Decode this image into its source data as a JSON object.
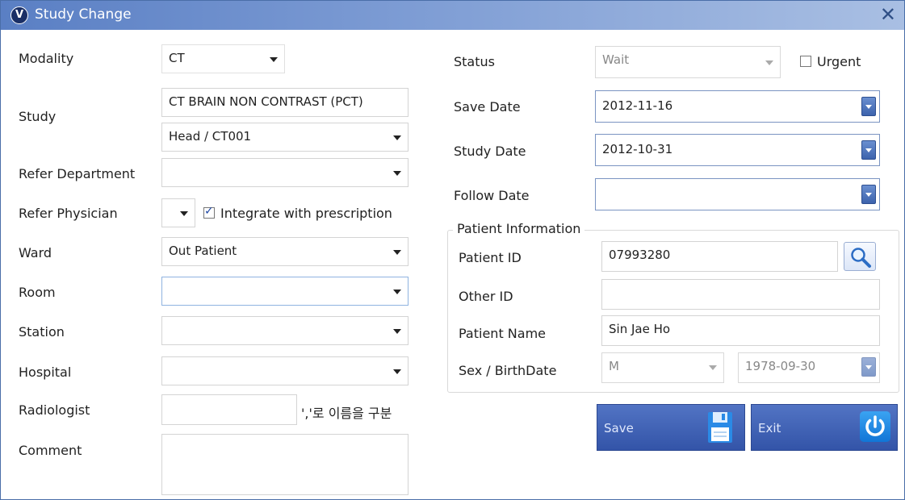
{
  "window": {
    "title": "Study Change",
    "app_icon_letter": "V",
    "close_glyph": "✕"
  },
  "left": {
    "modality": {
      "label": "Modality",
      "value": "CT"
    },
    "study": {
      "label": "Study",
      "name": "CT BRAIN NON CONTRAST (PCT)",
      "code": "Head / CT001"
    },
    "refer_department": {
      "label": "Refer Department",
      "value": ""
    },
    "refer_physician": {
      "label": "Refer Physician",
      "value": "",
      "integrate_label": "Integrate with prescription",
      "integrate_checked": true
    },
    "ward": {
      "label": "Ward",
      "value": "Out Patient"
    },
    "room": {
      "label": "Room",
      "value": ""
    },
    "station": {
      "label": "Station",
      "value": ""
    },
    "hospital": {
      "label": "Hospital",
      "value": ""
    },
    "radiologist": {
      "label": "Radiologist",
      "value": "",
      "hint": "','로 이름을 구분"
    },
    "comment": {
      "label": "Comment",
      "value": ""
    }
  },
  "right": {
    "status": {
      "label": "Status",
      "value": "Wait"
    },
    "urgent": {
      "label": "Urgent",
      "checked": false
    },
    "save_date": {
      "label": "Save Date",
      "value": "2012-11-16"
    },
    "study_date": {
      "label": "Study Date",
      "value": "2012-10-31"
    },
    "follow_date": {
      "label": "Follow Date",
      "value": ""
    },
    "patient_info": {
      "title": "Patient Information",
      "patient_id": {
        "label": "Patient ID",
        "value": "07993280"
      },
      "other_id": {
        "label": "Other ID",
        "value": ""
      },
      "patient_name": {
        "label": "Patient Name",
        "value": "Sin Jae Ho"
      },
      "sex_birth": {
        "label": "Sex / BirthDate",
        "sex": "M",
        "birthdate": "1978-09-30"
      }
    }
  },
  "buttons": {
    "save": "Save",
    "exit": "Exit"
  },
  "icons": {
    "app": "app-logo-icon",
    "close": "close-icon",
    "search": "search-icon",
    "save": "floppy-disk-icon",
    "exit": "power-icon"
  },
  "colors": {
    "titlebar": "#5a7fc4",
    "button": "#3f62b6",
    "exit_icon": "#1e8be6"
  }
}
